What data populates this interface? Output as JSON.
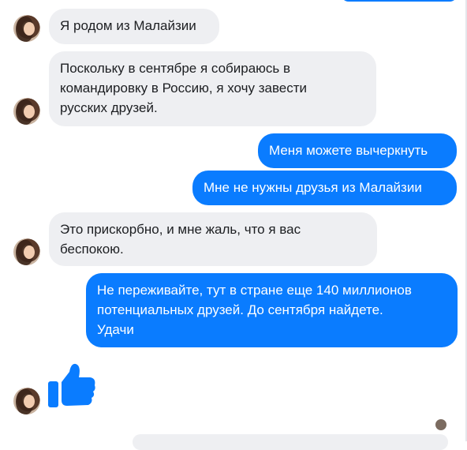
{
  "messages": [
    {
      "text": "Я родом из Малайзии"
    },
    {
      "line1": "Поскольку в сентябре я собираюсь в",
      "line2": "командировку в Россию, я хочу завести",
      "line3": "русских друзей."
    },
    {
      "text": "Меня можете вычеркнуть"
    },
    {
      "text": "Мне не нужны друзья из Малайзии"
    },
    {
      "line1": "Это прискорбно, и мне жаль, что я вас",
      "line2": "беспокою."
    },
    {
      "line1": "Не переживайте, тут в стране еще 140 миллионов",
      "line2": "потенциальных друзей. До сентября найдете.",
      "line3": "Удачи"
    }
  ],
  "icons": {
    "like": "thumbs-up-icon",
    "avatar": "contact-avatar"
  },
  "colors": {
    "outgoing": "#0a7cff",
    "incoming": "#eeeff2",
    "outgoing_text": "#ffffff",
    "incoming_text": "#1c1e21"
  }
}
